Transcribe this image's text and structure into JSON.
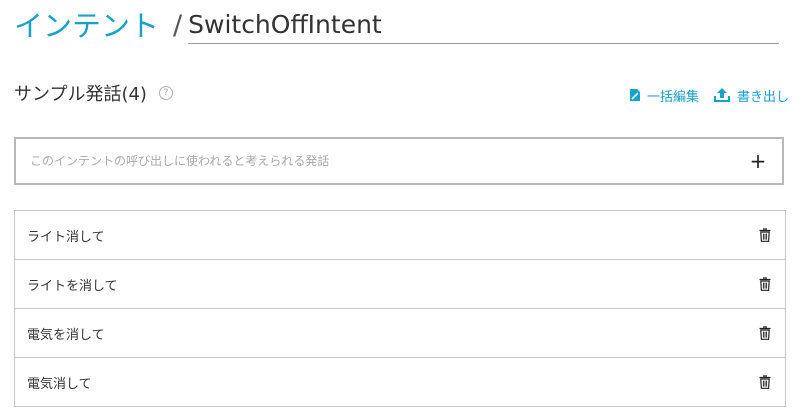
{
  "header": {
    "breadcrumb_parent": "インテント",
    "separator": "/",
    "intent_name": "SwitchOffIntent"
  },
  "section": {
    "title": "サンプル発話(4)",
    "help_symbol": "?",
    "help_icon": "question-circle-icon"
  },
  "actions": {
    "bulk_edit_label": "一括編集",
    "bulk_edit_icon": "document-edit-icon",
    "export_label": "書き出し",
    "export_icon": "upload-icon"
  },
  "new_utterance": {
    "placeholder": "このインテントの呼び出しに使われると考えられる発話",
    "value": "",
    "add_symbol": "+"
  },
  "utterances": [
    {
      "text": "ライト消して"
    },
    {
      "text": "ライトを消して"
    },
    {
      "text": "電気を消して"
    },
    {
      "text": "電気消して"
    }
  ],
  "colors": {
    "accent": "#16a2c9",
    "text": "#333333",
    "border": "#c8c8c8",
    "input_border": "#b8b8bc",
    "placeholder": "#a9a9a9"
  }
}
